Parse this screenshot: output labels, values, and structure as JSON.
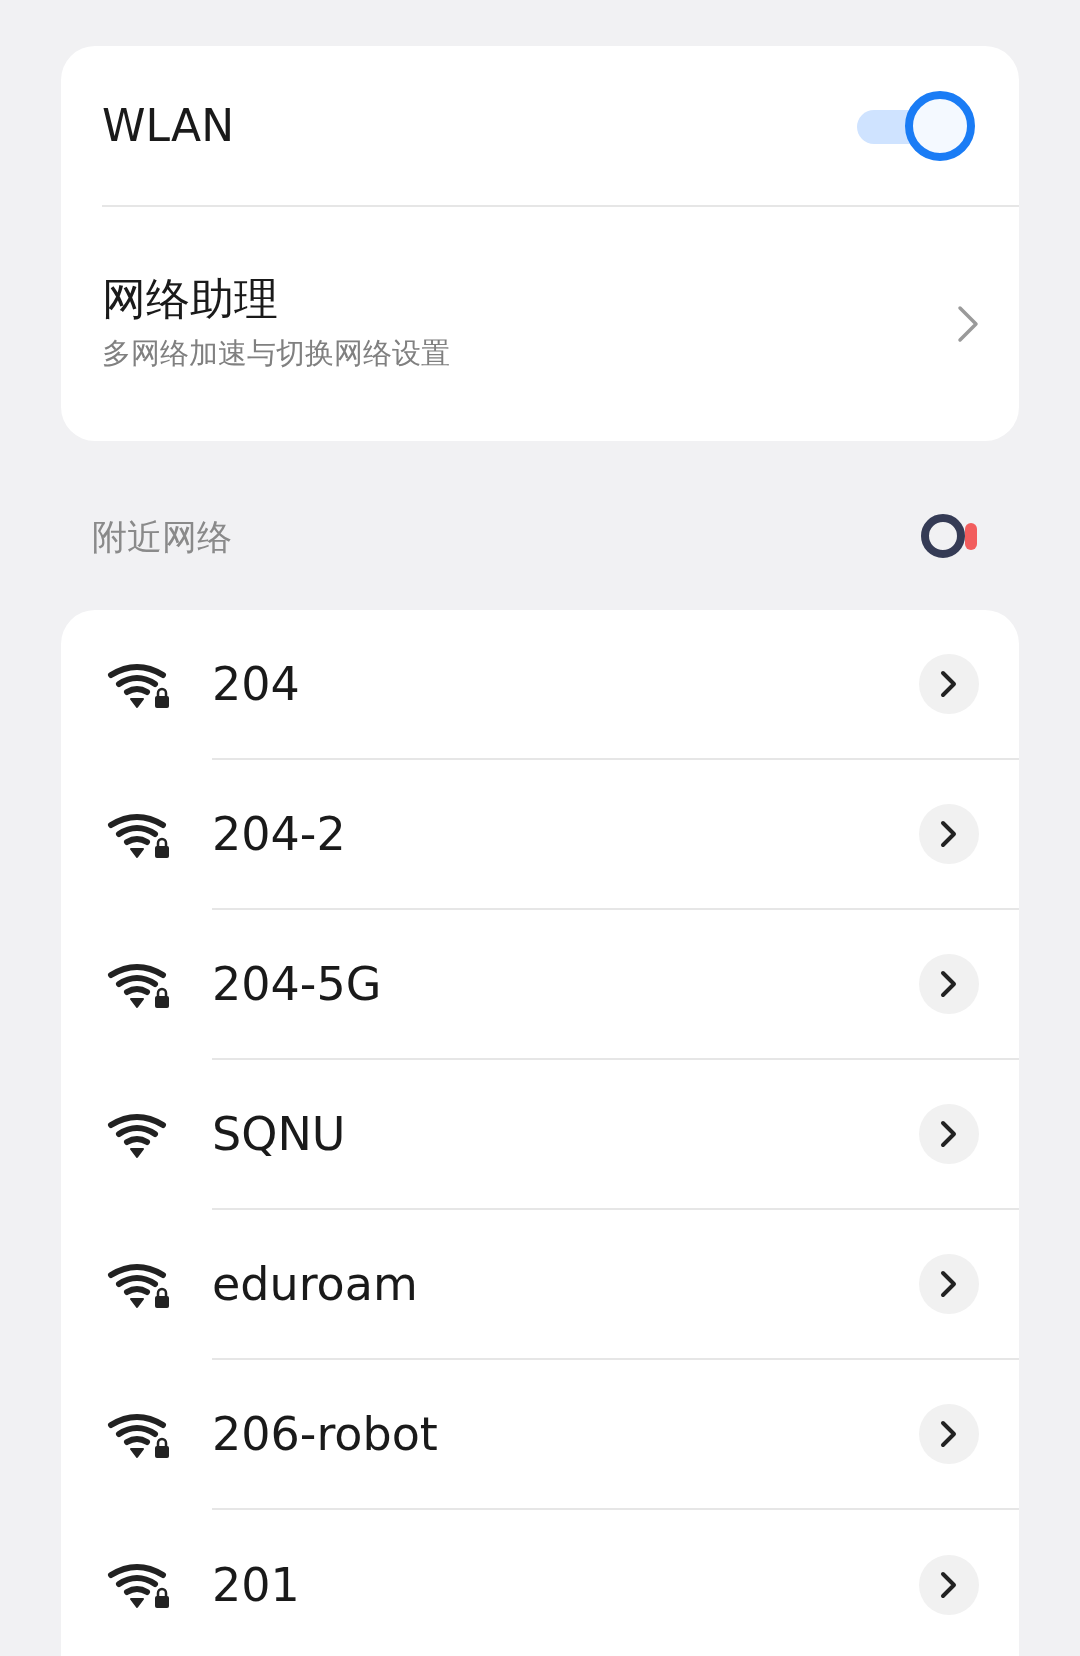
{
  "wlan": {
    "label": "WLAN",
    "on": true
  },
  "assistant": {
    "title": "网络助理",
    "subtitle": "多网络加速与切换网络设置"
  },
  "nearby": {
    "header": "附近网络"
  },
  "networks": [
    {
      "name": "204",
      "secured": true
    },
    {
      "name": "204-2",
      "secured": true
    },
    {
      "name": "204-5G",
      "secured": true
    },
    {
      "name": "SQNU",
      "secured": false
    },
    {
      "name": "eduroam",
      "secured": true
    },
    {
      "name": "206-robot",
      "secured": true
    },
    {
      "name": "201",
      "secured": true
    }
  ]
}
